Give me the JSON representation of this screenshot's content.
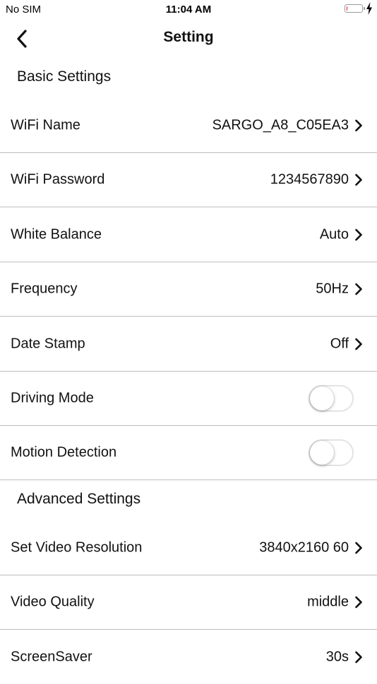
{
  "status_bar": {
    "carrier": "No SIM",
    "time": "11:04 AM",
    "battery_level": 0.08,
    "battery_color": "#e02020"
  },
  "nav": {
    "title": "Setting",
    "back_icon": "chevron-left-icon"
  },
  "basic_settings": {
    "header": "Basic Settings",
    "wifi_name": {
      "label": "WiFi Name",
      "value": "SARGO_A8_C05EA3"
    },
    "wifi_password": {
      "label": "WiFi Password",
      "value": "1234567890"
    },
    "white_balance": {
      "label": "White Balance",
      "value": "Auto"
    },
    "frequency": {
      "label": "Frequency",
      "value": "50Hz"
    },
    "date_stamp": {
      "label": "Date Stamp",
      "value": "Off"
    },
    "driving_mode": {
      "label": "Driving Mode",
      "enabled": false
    },
    "motion_detection": {
      "label": "Motion Detection",
      "enabled": false
    }
  },
  "advanced_settings": {
    "header": "Advanced Settings",
    "video_resolution": {
      "label": "Set Video Resolution",
      "value": "3840x2160 60"
    },
    "video_quality": {
      "label": "Video Quality",
      "value": "middle"
    },
    "screensaver": {
      "label": "ScreenSaver",
      "value": "30s"
    }
  }
}
